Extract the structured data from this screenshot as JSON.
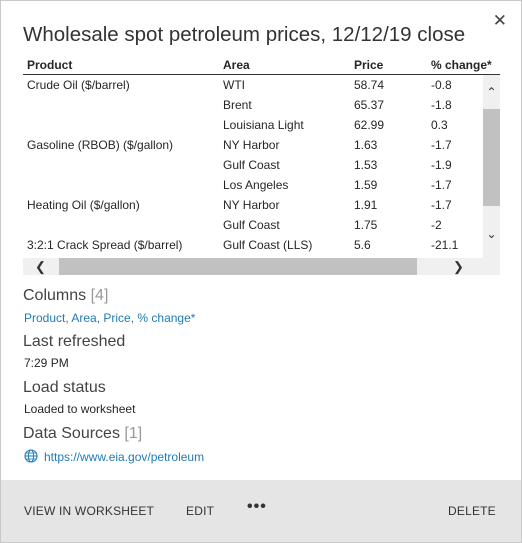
{
  "title": "Wholesale spot petroleum prices, 12/12/19 close",
  "table": {
    "headers": [
      "Product",
      "Area",
      "Price",
      "% change*"
    ],
    "rows": [
      [
        "Crude Oil ($/barrel)",
        "WTI",
        "58.74",
        "-0.8"
      ],
      [
        "",
        "Brent",
        "65.37",
        "-1.8"
      ],
      [
        "",
        "Louisiana Light",
        "62.99",
        "0.3"
      ],
      [
        "Gasoline (RBOB) ($/gallon)",
        "NY Harbor",
        "1.63",
        "-1.7"
      ],
      [
        "",
        "Gulf Coast",
        "1.53",
        "-1.9"
      ],
      [
        "",
        "Los Angeles",
        "1.59",
        "-1.7"
      ],
      [
        "Heating Oil ($/gallon)",
        "NY Harbor",
        "1.91",
        "-1.7"
      ],
      [
        "",
        "Gulf Coast",
        "1.75",
        "-2"
      ],
      [
        "3:2:1 Crack Spread ($/barrel)",
        "Gulf Coast (LLS)",
        "5.6",
        "-21.1"
      ]
    ]
  },
  "columns": {
    "label": "Columns",
    "count": "[4]",
    "list": "Product, Area, Price, % change*"
  },
  "last_refreshed": {
    "label": "Last refreshed",
    "value": "7:29 PM"
  },
  "load_status": {
    "label": "Load status",
    "value": "Loaded to worksheet"
  },
  "data_sources": {
    "label": "Data Sources",
    "count": "[1]",
    "url": "https://www.eia.gov/petroleum"
  },
  "footer": {
    "view": "VIEW IN WORKSHEET",
    "edit": "EDIT",
    "more": "•••",
    "delete": "DELETE"
  },
  "icons": {
    "close": "✕",
    "up": "⌃",
    "down": "⌄",
    "left": "❮",
    "right": "❯"
  }
}
